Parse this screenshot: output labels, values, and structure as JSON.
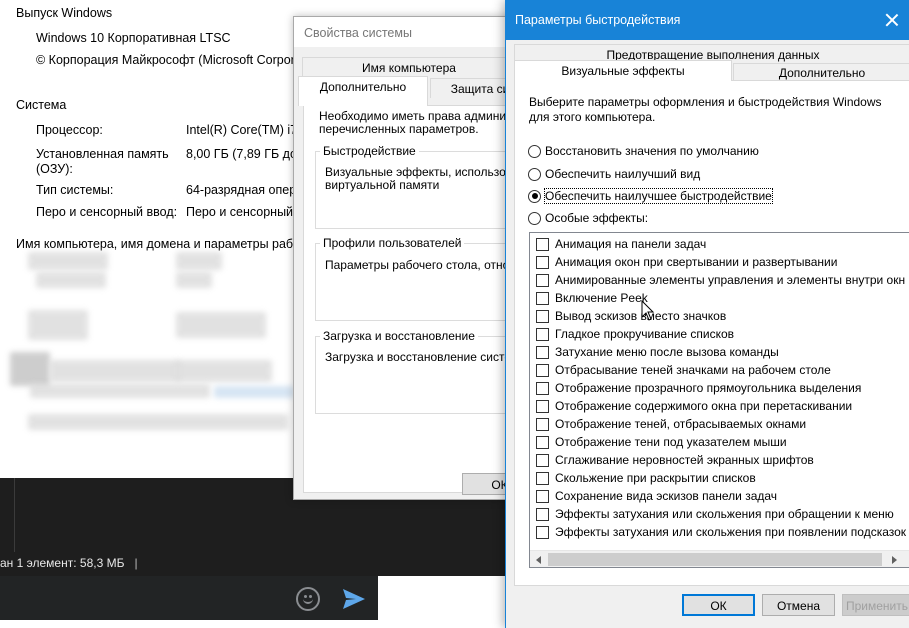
{
  "sysinfo": {
    "edition_section": "Выпуск Windows",
    "edition_name": "Windows 10 Корпоративная LTSC",
    "copyright": "© Корпорация Майкрософт (Microsoft Corpora",
    "system_section": "Система",
    "rows": [
      {
        "label": "Процессор:",
        "value": "Intel(R) Core(TM) i7-"
      },
      {
        "label": "Установленная память",
        "label2": "(ОЗУ):",
        "value": "8,00 ГБ (7,89 ГБ дост"
      },
      {
        "label": "Тип системы:",
        "value": "64-разрядная опера"
      },
      {
        "label": "Перо и сенсорный ввод:",
        "value": "Перо и сенсорный"
      }
    ],
    "computer_section": "Имя компьютера, имя домена и параметры рабо"
  },
  "messenger": {
    "status": "ан 1 элемент: 58,3 МБ",
    "status_sep": "|",
    "emoji_icon": "emoji-icon",
    "send_icon": "send-icon",
    "send_color": "#5ea7ea"
  },
  "sysprops": {
    "title": "Свойства системы",
    "tabs_row1": [
      "Имя компьютера"
    ],
    "tabs_row2": [
      "Дополнительно",
      "Защита си"
    ],
    "intro_line1": "Необходимо иметь права админист",
    "intro_line2": "перечисленных параметров.",
    "groups": [
      {
        "label": "Быстродействие",
        "line1": "Визуальные эффекты, использова",
        "line2": "виртуальной памяти"
      },
      {
        "label": "Профили пользователей",
        "line1": "Параметры рабочего стола, относя",
        "line2": ""
      },
      {
        "label": "Загрузка и восстановление",
        "line1": "Загрузка и восстановление систем",
        "line2": ""
      }
    ],
    "ok_label": "ОК"
  },
  "perf": {
    "title": "Параметры быстродействия",
    "tab_top": "Предотвращение выполнения данных",
    "tab_visual": "Визуальные эффекты",
    "tab_advanced": "Дополнительно",
    "desc_line1": "Выберите параметры оформления и быстродействия Windows",
    "desc_line2": "для этого компьютера.",
    "radios": [
      {
        "label": "Восстановить значения по умолчанию",
        "selected": false
      },
      {
        "label": "Обеспечить наилучший вид",
        "selected": false
      },
      {
        "label": "Обеспечить наилучшее быстродействие",
        "selected": true
      },
      {
        "label": "Особые эффекты:",
        "selected": false
      }
    ],
    "effects": [
      "Анимация на панели задач",
      "Анимация окон при свертывании и развертывании",
      "Анимированные элементы управления и элементы внутри окн",
      "Включение Peek",
      "Вывод эскизов вместо значков",
      "Гладкое прокручивание списков",
      "Затухание меню после вызова команды",
      "Отбрасывание теней значками на рабочем столе",
      "Отображение прозрачного прямоугольника выделения",
      "Отображение содержимого окна при перетаскивании",
      "Отображение теней, отбрасываемых окнами",
      "Отображение тени под указателем мыши",
      "Сглаживание неровностей экранных шрифтов",
      "Скольжение при раскрытии списков",
      "Сохранение вида эскизов панели задач",
      "Эффекты затухания или скольжения при обращении к меню",
      "Эффекты затухания или скольжения при появлении подсказок"
    ],
    "ok_label": "ОК",
    "cancel_label": "Отмена",
    "apply_label": "Применить",
    "accent_color": "#1883d7"
  }
}
